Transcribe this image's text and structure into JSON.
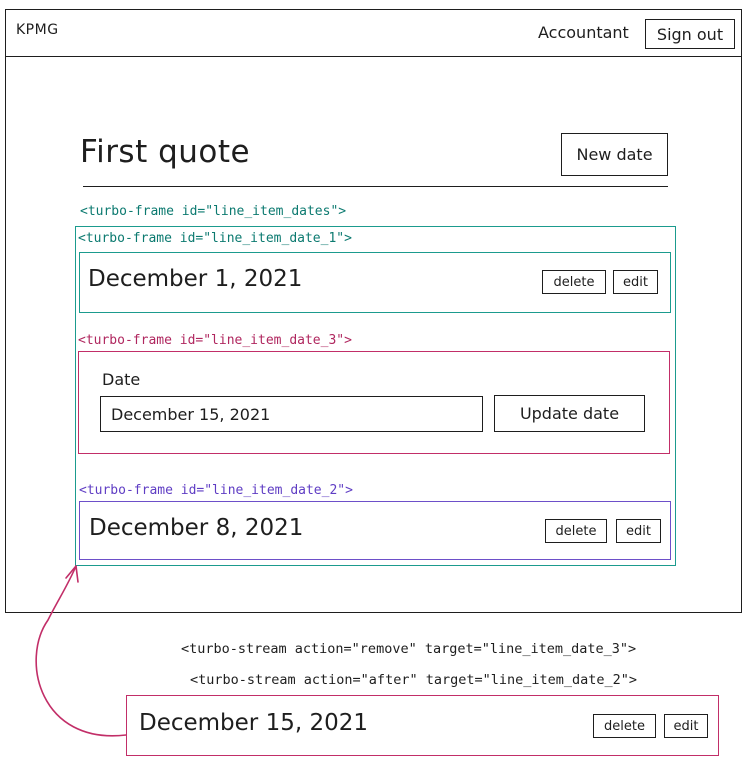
{
  "navbar": {
    "brand": "KPMG",
    "role": "Accountant",
    "sign_out_label": "Sign out"
  },
  "page": {
    "title": "First quote",
    "new_date_label": "New date"
  },
  "frames": {
    "outer_label": "<turbo-frame id=\"line_item_dates\">",
    "frame_1": {
      "label": "<turbo-frame id=\"line_item_date_1\">",
      "date": "December 1, 2021",
      "delete_label": "delete",
      "edit_label": "edit"
    },
    "frame_3": {
      "label": "<turbo-frame id=\"line_item_date_3\">",
      "field_label": "Date",
      "field_value": "December 15, 2021",
      "submit_label": "Update date"
    },
    "frame_2": {
      "label": "<turbo-frame id=\"line_item_date_2\">",
      "date": "December 8, 2021",
      "delete_label": "delete",
      "edit_label": "edit"
    }
  },
  "streams": {
    "remove": "<turbo-stream action=\"remove\" target=\"line_item_date_3\">",
    "after": "<turbo-stream action=\"after\" target=\"line_item_date_2\">"
  },
  "new_item": {
    "date": "December 15, 2021",
    "delete_label": "delete",
    "edit_label": "edit"
  },
  "colors": {
    "ink": "#1e1e1e",
    "teal": "#1b9b8e",
    "crimson": "#c22e68",
    "violet": "#6d4fc9"
  }
}
